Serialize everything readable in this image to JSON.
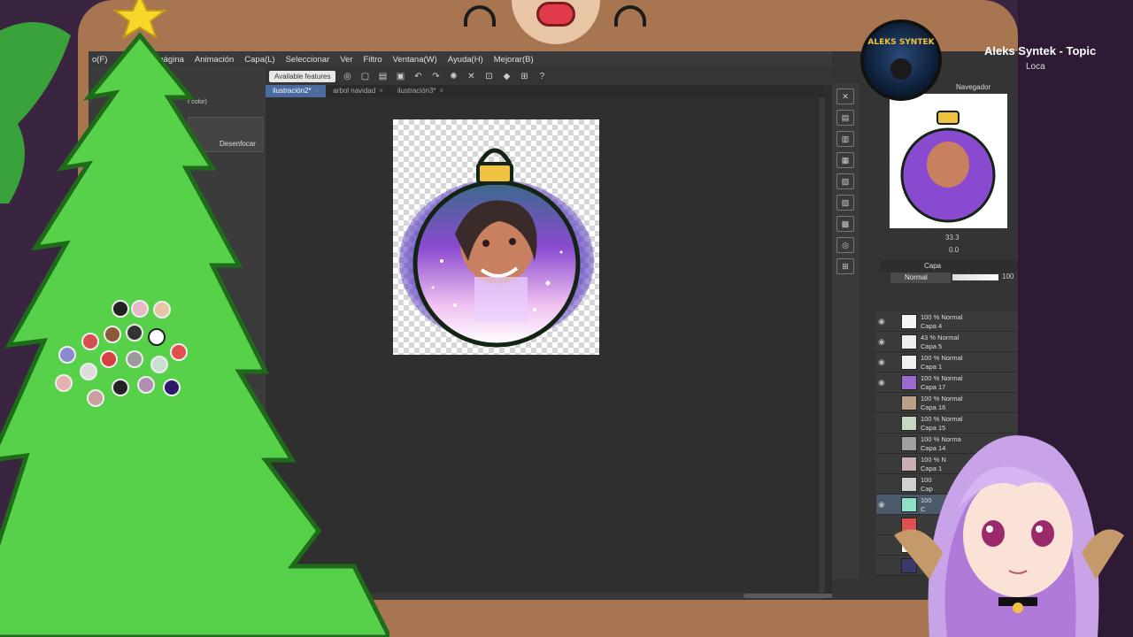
{
  "menu": [
    "o(F)",
    "stión de la página",
    "Animación",
    "Capa(L)",
    "Seleccionar",
    "Ver",
    "Filtro",
    "Ventana(W)",
    "Ayuda(H)",
    "Mejorar(B)"
  ],
  "toolbar": {
    "feature_label": "Available features"
  },
  "tabs": [
    {
      "label": "ilustración2*",
      "active": true
    },
    {
      "label": "arbol navidad",
      "active": false
    },
    {
      "label": "ilustración3*",
      "active": false
    }
  ],
  "left_panel": {
    "color_label": "r color)",
    "brush_label": "Desenfocar"
  },
  "navigator": {
    "label": "Navegador",
    "zoom": "33.3",
    "angle": "0.0"
  },
  "layers": {
    "header": "Capa",
    "blend_mode": "Normal",
    "opacity": "100",
    "items": [
      {
        "pct": "100 % Normal",
        "name": "Capa 4",
        "visible": true,
        "thumb": "#f5f5f5"
      },
      {
        "pct": "43 % Normal",
        "name": "Capa 5",
        "visible": true,
        "thumb": "#eeeeee"
      },
      {
        "pct": "100 % Normal",
        "name": "Capa 1",
        "visible": true,
        "thumb": "#f0f0f0"
      },
      {
        "pct": "100 % Normal",
        "name": "Capa 17",
        "visible": true,
        "thumb": "#9a6ad0"
      },
      {
        "pct": "100 % Normal",
        "name": "Capa 16",
        "visible": false,
        "thumb": "#b8a08a"
      },
      {
        "pct": "100 % Normal",
        "name": "Capa 15",
        "visible": false,
        "thumb": "#c8d8c0"
      },
      {
        "pct": "100 % Norma",
        "name": "Capa 14",
        "visible": false,
        "thumb": "#a0a0a0"
      },
      {
        "pct": "100 % N",
        "name": "Capa 1",
        "visible": false,
        "thumb": "#c8b0b0"
      },
      {
        "pct": "100",
        "name": "Cap",
        "visible": false,
        "thumb": "#d0d0d0"
      },
      {
        "pct": "100",
        "name": "C",
        "visible": true,
        "thumb": "#8ee0c8"
      },
      {
        "pct": "",
        "name": "",
        "visible": false,
        "thumb": "#e05050"
      },
      {
        "pct": "",
        "name": "",
        "visible": false,
        "thumb": "#f0f0f0"
      },
      {
        "pct": "",
        "name": "",
        "visible": false,
        "thumb": "#3a3a6a"
      }
    ]
  },
  "music": {
    "title": "Aleks Syntek - Topic",
    "artist": "Loca",
    "album_text": "ALEKS SYNTEK"
  },
  "colors": {
    "tree": "#57d04a",
    "tree_outline": "#1e6b1a",
    "frame": "#a77650",
    "star": "#f6d72a"
  }
}
